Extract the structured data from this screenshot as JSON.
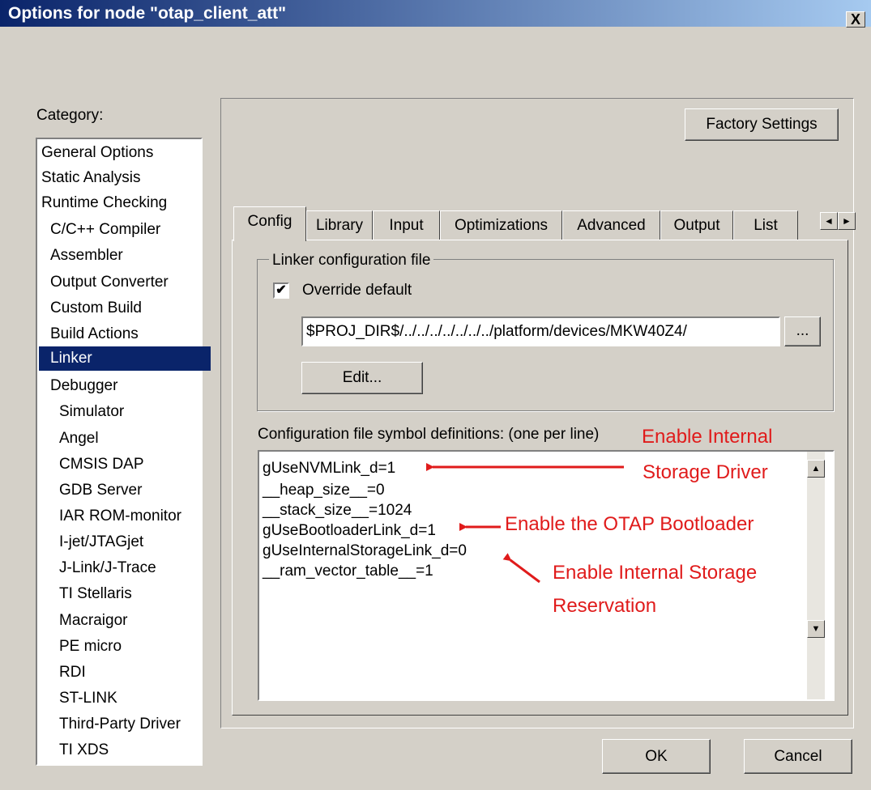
{
  "window": {
    "title": "Options for node \"otap_client_att\"",
    "close_label": "X"
  },
  "category": {
    "label": "Category:",
    "items": [
      "General Options",
      "Static Analysis",
      "Runtime Checking",
      "C/C++ Compiler",
      "Assembler",
      "Output Converter",
      "Custom Build",
      "Build Actions",
      "Linker",
      "Debugger",
      "Simulator",
      "Angel",
      "CMSIS DAP",
      "GDB Server",
      "IAR ROM-monitor",
      "I-jet/JTAGjet",
      "J-Link/J-Trace",
      "TI Stellaris",
      "Macraigor",
      "PE micro",
      "RDI",
      "ST-LINK",
      "Third-Party Driver",
      "TI XDS"
    ],
    "selected": "Linker"
  },
  "factory_button": "Factory Settings",
  "tabs": [
    "Config",
    "Library",
    "Input",
    "Optimizations",
    "Advanced",
    "Output",
    "List"
  ],
  "active_tab": "Config",
  "tab_scroll": {
    "left": "◄",
    "right": "►"
  },
  "linker_config": {
    "legend": "Linker configuration file",
    "override_label": "Override default",
    "override_checked": true,
    "check_mark": "✔",
    "path_value": "$PROJ_DIR$/../../../../../../../platform/devices/MKW40Z4/",
    "browse_label": "...",
    "edit_label": "Edit..."
  },
  "symbols": {
    "label": "Configuration file symbol definitions: (one per line)",
    "lines": [
      "gUseNVMLink_d=1",
      "__heap_size__=0",
      "__stack_size__=1024",
      "gUseBootloaderLink_d=1",
      "gUseInternalStorageLink_d=0",
      "__ram_vector_table__=1"
    ],
    "scroll_up": "▲",
    "scroll_down": "▼"
  },
  "annotations": {
    "internal_driver": [
      "Enable Internal",
      "Storage Driver"
    ],
    "bootloader": "Enable the OTAP Bootloader",
    "storage_reservation": [
      "Enable Internal Storage",
      "Reservation"
    ],
    "color": "#e01b1b"
  },
  "buttons": {
    "ok": "OK",
    "cancel": "Cancel"
  }
}
